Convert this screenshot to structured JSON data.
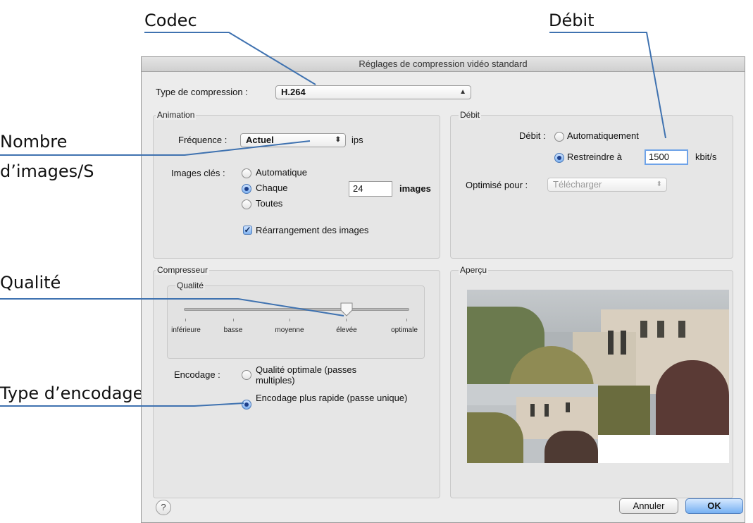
{
  "callouts": {
    "codec": "Codec",
    "debit": "Débit",
    "nombre_line1": "Nombre",
    "nombre_line2": "d’images/S",
    "qualite": "Qualité",
    "type_encodage": "Type d’encodage"
  },
  "dialog": {
    "title": "Réglages de compression vidéo standard",
    "compression_type": {
      "label": "Type de compression :",
      "value": "H.264"
    },
    "animation": {
      "group_title": "Animation",
      "frequence_label": "Fréquence :",
      "frequence_value": "Actuel",
      "frequence_unit": "ips",
      "keyframes_label": "Images clés :",
      "keyframe_options": [
        "Automatique",
        "Chaque",
        "Toutes"
      ],
      "keyframe_selected": "Chaque",
      "keyframe_interval": "24",
      "keyframe_unit": "images",
      "reorder_label": "Réarrangement des images",
      "reorder_checked": true
    },
    "debit": {
      "group_title": "Débit",
      "label": "Débit :",
      "option_auto": "Automatiquement",
      "option_restrict": "Restreindre à",
      "selected": "Restreindre à",
      "value": "1500",
      "unit": "kbit/s",
      "optimise_label": "Optimisé pour :",
      "optimise_value": "Télécharger"
    },
    "compresseur": {
      "group_title": "Compresseur",
      "qualite_title": "Qualité",
      "quality_levels": [
        "inférieure",
        "basse",
        "moyenne",
        "élevée",
        "optimale"
      ],
      "quality_selected": "élevée",
      "encodage_label": "Encodage :",
      "encodage_option1": "Qualité optimale (passes multiples)",
      "encodage_option2": "Encodage plus rapide (passe unique)",
      "encodage_selected": "Encodage plus rapide (passe unique)"
    },
    "apercu": {
      "group_title": "Aperçu"
    },
    "help_symbol": "?",
    "cancel_label": "Annuler",
    "ok_label": "OK"
  },
  "colors": {
    "leader_line": "#3f72b0",
    "focus_ring": "#6fa3e8",
    "default_button": "#76b0f2"
  }
}
